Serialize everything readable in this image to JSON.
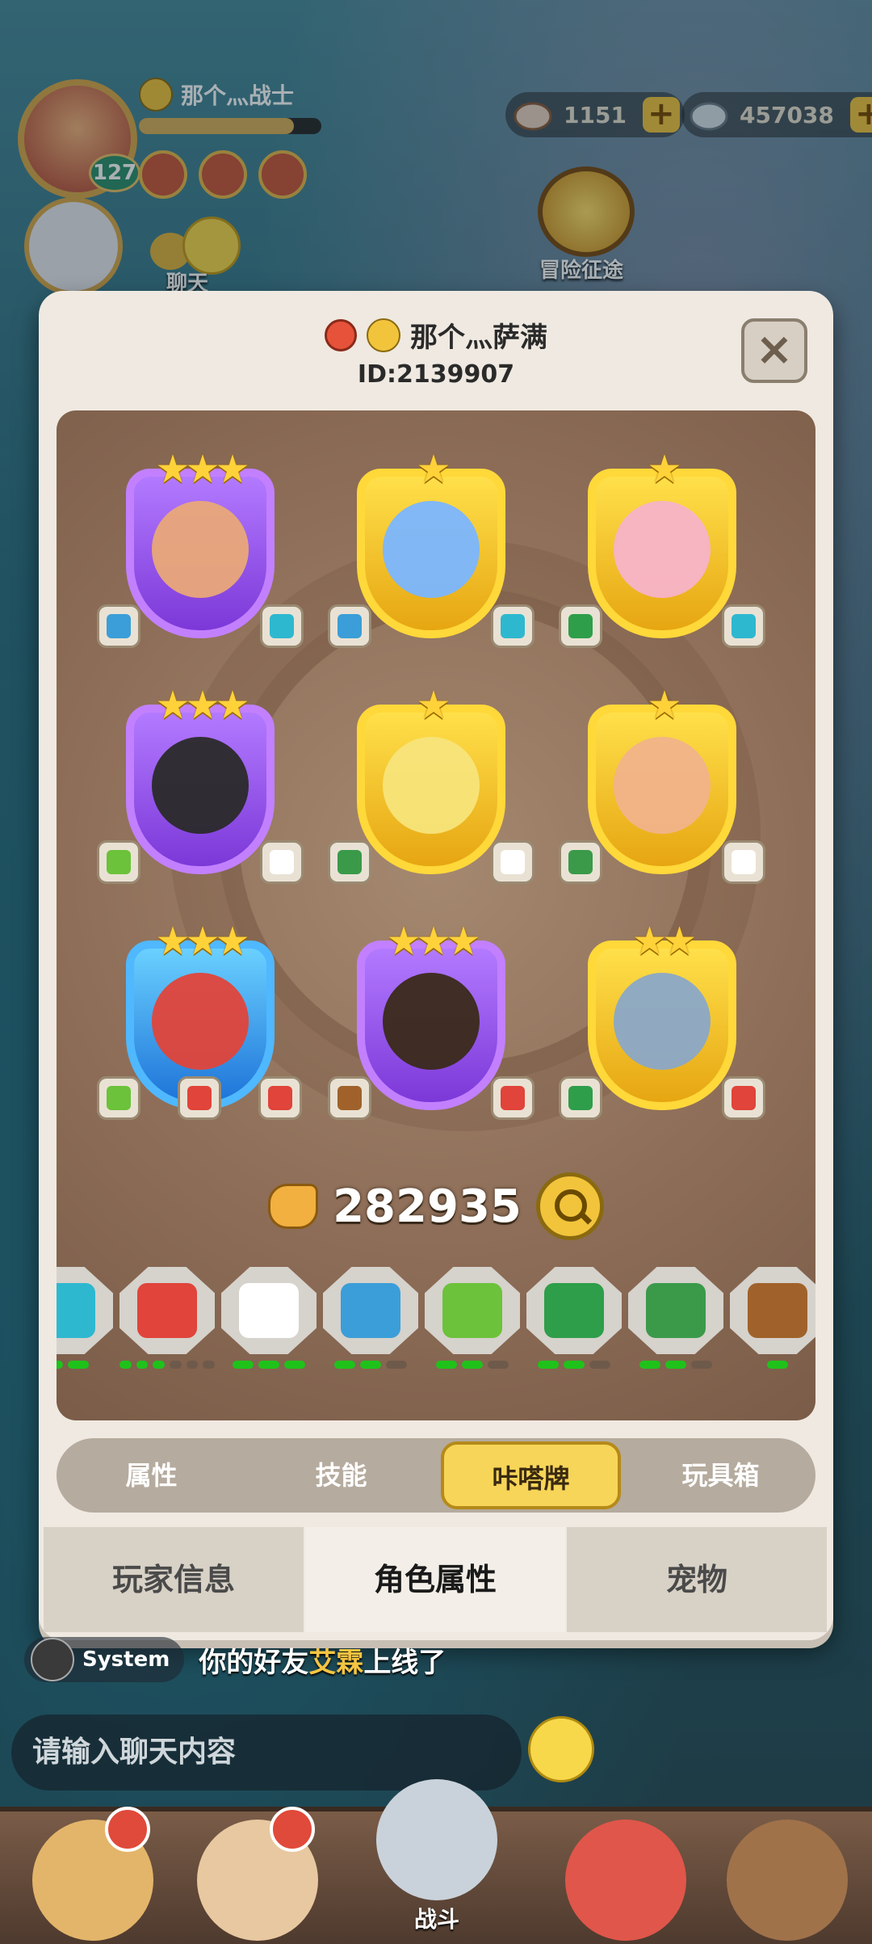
{
  "hud": {
    "player_name": "那个灬战士",
    "level": "127",
    "xp_fraction": 0.85,
    "currency1": "1151",
    "currency2": "457038",
    "adventure_label": "冒险征途",
    "chat_label": "聊天"
  },
  "modal": {
    "player_name": "那个灬萨满",
    "player_id": "ID:2139907",
    "close_label": "×",
    "power": "282935",
    "cards": [
      {
        "stars": "★★★",
        "frame": "purple",
        "creature_color": "#e9a878",
        "tags": [
          {
            "color": "#3b9ed8"
          },
          {
            "color": "#2eb8d0"
          }
        ]
      },
      {
        "stars": "★",
        "frame": "gold",
        "creature_color": "#7ab6ff",
        "tags": [
          {
            "color": "#3b9ed8"
          },
          {
            "color": "#2eb8d0"
          }
        ]
      },
      {
        "stars": "★",
        "frame": "gold",
        "creature_color": "#f7b3c9",
        "tags": [
          {
            "color": "#2e9e4a"
          },
          {
            "color": "#2eb8d0"
          }
        ]
      },
      {
        "stars": "★★★",
        "frame": "purple",
        "creature_color": "#2a2a2a",
        "tags": [
          {
            "color": "#6cc23a"
          },
          {
            "color": "#ffffff"
          }
        ]
      },
      {
        "stars": "★",
        "frame": "gold",
        "creature_color": "#f7e47a",
        "tags": [
          {
            "color": "#3a9a4a"
          },
          {
            "color": "#ffffff"
          }
        ]
      },
      {
        "stars": "★",
        "frame": "gold",
        "creature_color": "#f1b38a",
        "tags": [
          {
            "color": "#3a9a4a"
          },
          {
            "color": "#ffffff"
          }
        ]
      },
      {
        "stars": "★★★",
        "frame": "blue",
        "creature_color": "#e0443a",
        "tags": [
          {
            "color": "#6cc23a"
          },
          {
            "color": "#e0443a"
          },
          {
            "color": "#e0443a"
          }
        ]
      },
      {
        "stars": "★★★",
        "frame": "purple",
        "creature_color": "#3a2a1a",
        "tags": [
          {
            "color": "#a0622a"
          },
          {
            "color": "#e0443a"
          }
        ]
      },
      {
        "stars": "★★",
        "frame": "gold",
        "creature_color": "#8aa8c8",
        "tags": [
          {
            "color": "#2e9e4a"
          },
          {
            "color": "#e0443a"
          }
        ]
      }
    ],
    "traits": [
      {
        "icon": "wind-icon",
        "color": "#2eb8d0",
        "pips_on": 2,
        "pips_off": 0
      },
      {
        "icon": "fire-rock-icon",
        "color": "#e0443a",
        "pips_on": 3,
        "pips_off": 3
      },
      {
        "icon": "fluff-icon",
        "color": "#ffffff",
        "pips_on": 3,
        "pips_off": 0
      },
      {
        "icon": "river-icon",
        "color": "#3b9ed8",
        "pips_on": 2,
        "pips_off": 1
      },
      {
        "icon": "grass-icon",
        "color": "#6cc23a",
        "pips_on": 2,
        "pips_off": 1
      },
      {
        "icon": "tree-icon",
        "color": "#2e9e4a",
        "pips_on": 2,
        "pips_off": 1
      },
      {
        "icon": "leaf-icon",
        "color": "#3a9a4a",
        "pips_on": 2,
        "pips_off": 1
      },
      {
        "icon": "mountain-icon",
        "color": "#a0622a",
        "pips_on": 1,
        "pips_off": 0
      }
    ],
    "subtabs": [
      "属性",
      "技能",
      "咔嗒牌",
      "玩具箱"
    ],
    "active_subtab": 2,
    "maintabs": [
      "玩家信息",
      "角色属性",
      "宠物"
    ],
    "active_maintab": 1
  },
  "chat": {
    "system_label": "System",
    "message_prefix": "你的好友",
    "message_name": "艾霖",
    "message_suffix": "上线了",
    "input_placeholder": "请输入聊天内容"
  },
  "nav": {
    "battle_label": "战斗"
  }
}
